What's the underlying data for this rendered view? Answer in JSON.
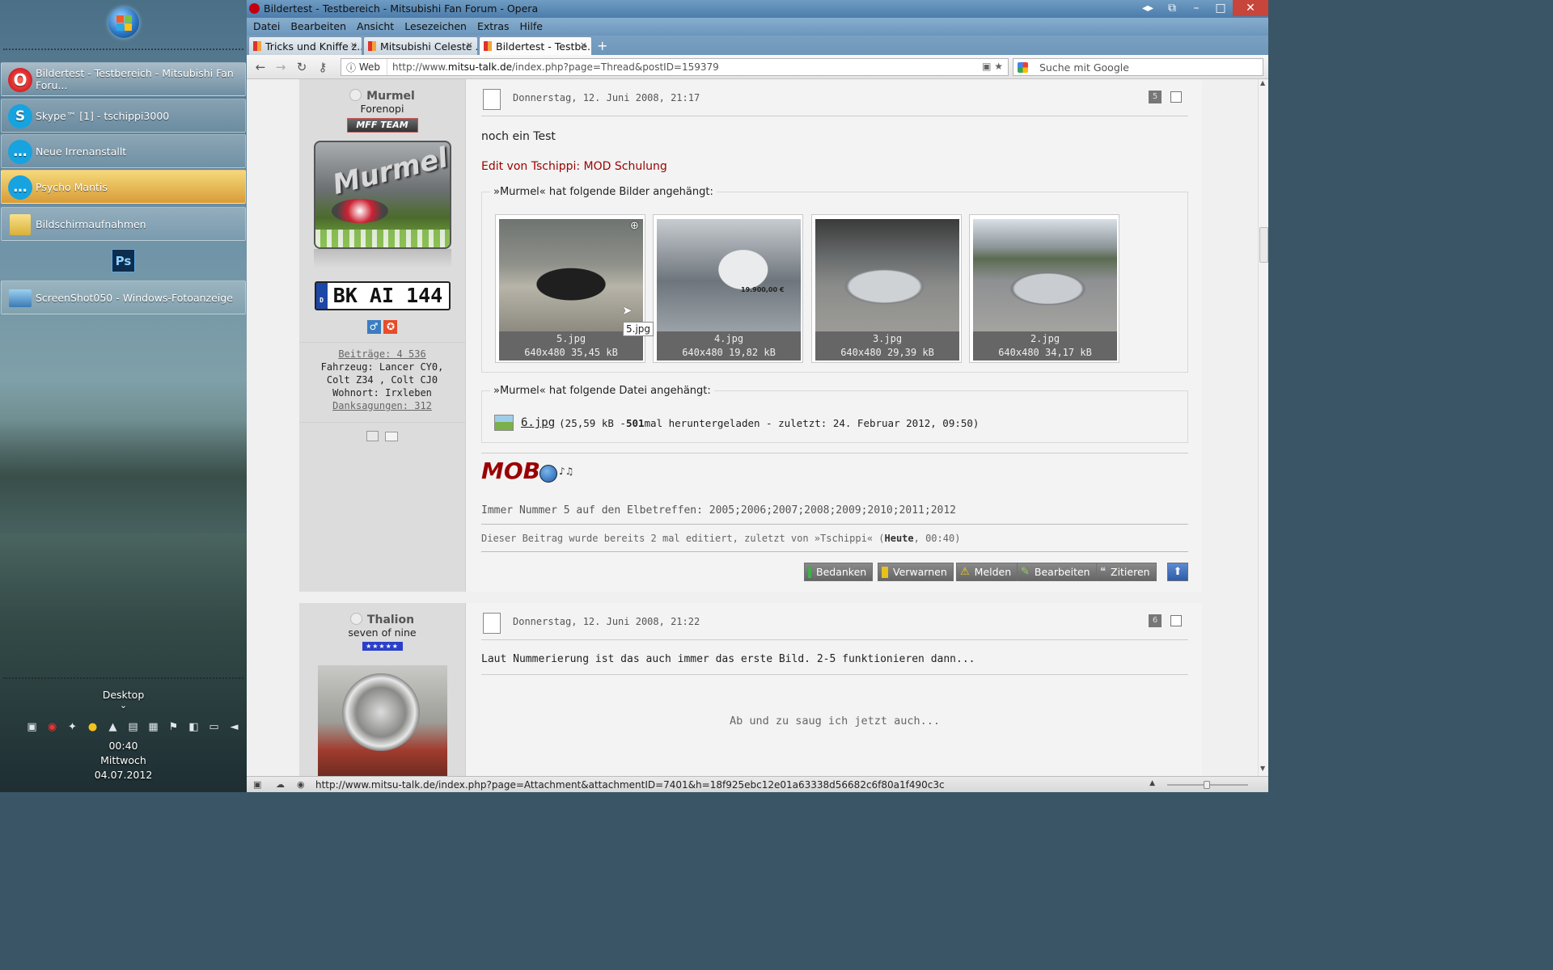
{
  "taskbar": {
    "items": [
      {
        "label": "Bildertest - Testbereich - Mitsubishi Fan Foru...",
        "icon": "opera-icon"
      },
      {
        "label": "Skype™ [1] - tschippi3000",
        "icon": "skype-icon"
      },
      {
        "label": "Neue Irrenanstallt",
        "icon": "skype-chat-icon"
      },
      {
        "label": "Psycho Mantis",
        "icon": "skype-chat-icon"
      },
      {
        "label": "Bildschirmaufnahmen",
        "icon": "folder-icon"
      },
      {
        "label": "ScreenShot050 - Windows-Fotoanzeige",
        "icon": "photo-viewer-icon"
      }
    ],
    "ps_label": "Ps",
    "desktop_label": "Desktop",
    "desktop_arrow": "⌄",
    "clock_time": "00:40",
    "clock_day": "Mittwoch",
    "clock_date": "04.07.2012"
  },
  "browser": {
    "window_title": "Bildertest - Testbereich - Mitsubishi Fan Forum - Opera",
    "menu": [
      "Datei",
      "Bearbeiten",
      "Ansicht",
      "Lesezeichen",
      "Extras",
      "Hilfe"
    ],
    "tabs": [
      {
        "label": "Tricks und Kniffe z..."
      },
      {
        "label": "Mitsubishi Celeste ..."
      },
      {
        "label": "Bildertest - Testbe..."
      }
    ],
    "tab_close": "×",
    "new_tab": "+",
    "address_prefix": "Web",
    "url_pre": "http://www.",
    "url_domain": "mitsu-talk.de",
    "url_post": "/index.php?page=Thread&postID=159379",
    "search_placeholder": "Suche mit Google",
    "status_url": "http://www.mitsu-talk.de/index.php?page=Attachment&attachmentID=7401&h=18f925ebc12e01a63338d56682c6f80a1f490c3c"
  },
  "post1": {
    "username": "Murmel",
    "rank": "Forenopi",
    "team_badge": "MFF TEAM",
    "avatar_text": "Murmel",
    "plate_country": "D",
    "plate_text": "BK AI 144",
    "stats": {
      "beitraege": "Beiträge: 4 536",
      "fahrzeug": "Fahrzeug: Lancer CY0, Colt Z34 , Colt CJ0",
      "wohnort": "Wohnort: Irxleben",
      "danksagungen": "Danksagungen: 312"
    },
    "date": "Donnerstag, 12. Juni 2008, 21:17",
    "number": "5",
    "body": "noch ein Test",
    "edit_note": "Edit von Tschippi: MOD Schulung",
    "images_legend": "»Murmel« hat folgende Bilder angehängt:",
    "images": [
      {
        "name": "5.jpg",
        "info": "640x480 35,45 kB"
      },
      {
        "name": "4.jpg",
        "info": "640x480 19,82 kB"
      },
      {
        "name": "3.jpg",
        "info": "640x480 29,39 kB"
      },
      {
        "name": "2.jpg",
        "info": "640x480 34,17 kB"
      }
    ],
    "tooltip": "5.jpg",
    "price_tag": "19.900,00 €",
    "file_legend": "»Murmel« hat folgende Datei angehängt:",
    "file_name": "6.jpg",
    "file_info_pre": "(25,59 kB - ",
    "file_count": "501",
    "file_info_post": " mal heruntergeladen - zuletzt: 24. Februar 2012, 09:50)",
    "signature_title": "MOB",
    "signature_line": "Immer Nummer 5 auf den Elbetreffen: 2005;2006;2007;2008;2009;2010;2011;2012",
    "edited_pre": "Dieser Beitrag wurde bereits 2 mal editiert, zuletzt von »Tschippi« (",
    "edited_bold": "Heute",
    "edited_post": ", 00:40)",
    "actions": [
      "Bedanken",
      "Verwarnen",
      "Melden",
      "Bearbeiten",
      "Zitieren"
    ]
  },
  "post2": {
    "username": "Thalion",
    "rank": "seven of nine",
    "date": "Donnerstag, 12. Juni 2008, 21:22",
    "number": "6",
    "body": "Laut Nummerierung ist das auch immer das erste Bild. 2-5 funktionieren dann...",
    "signature": "Ab und zu saug ich jetzt auch..."
  }
}
